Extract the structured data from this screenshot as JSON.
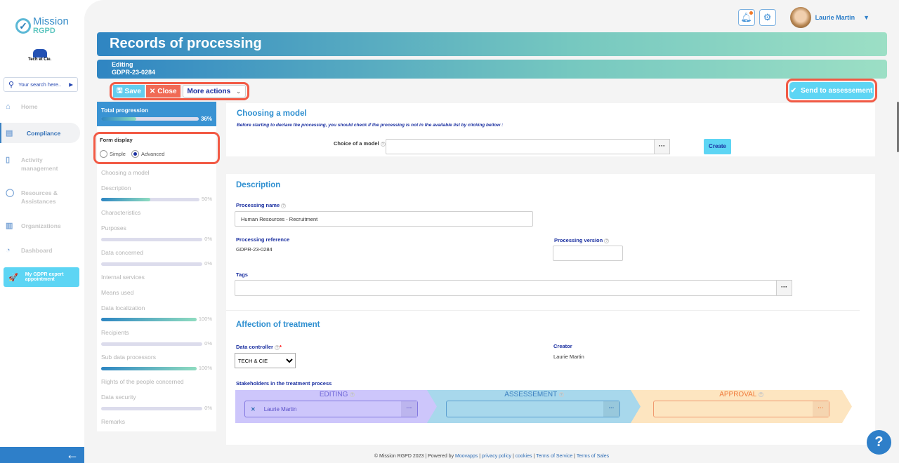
{
  "sidebar": {
    "logo_line1": "Mission",
    "logo_line2": "RGPD",
    "client_name": "Tech et Cie.",
    "search_placeholder": "Your search here..",
    "items": [
      {
        "label": "Home",
        "icon": "home-icon"
      },
      {
        "label": "Compliance",
        "icon": "document-icon",
        "active": true
      },
      {
        "label": "Activity management",
        "icon": "bookmark-icon"
      },
      {
        "label": "Resources & Assistances",
        "icon": "chat-icon"
      },
      {
        "label": "Organizations",
        "icon": "buildings-icon"
      },
      {
        "label": "Dashboard",
        "icon": "dashboard-icon"
      }
    ],
    "appointment": "My GDPR expert appointment",
    "back_icon": "arrow-left-icon"
  },
  "header": {
    "user": "Laurie Martin",
    "notification_icon": "bell-icon",
    "settings_icon": "gear-icon"
  },
  "page": {
    "title": "Records of processing",
    "status": "Editing",
    "reference": "GDPR-23-0284"
  },
  "toolbar": {
    "save": "Save",
    "close": "Close",
    "more": "More actions",
    "send": "Send to assessement"
  },
  "progress": {
    "label": "Total progression",
    "value": 36,
    "value_text": "36%"
  },
  "form_display": {
    "label": "Form display",
    "options": [
      "Simple",
      "Advanced"
    ],
    "selected": "Advanced"
  },
  "steps": [
    {
      "label": "Choosing a model"
    },
    {
      "label": "Description",
      "progress": 50,
      "text": "50%"
    },
    {
      "label": "Characteristics"
    },
    {
      "label": "Purposes",
      "progress": 0,
      "text": "0%"
    },
    {
      "label": "Data concerned",
      "progress": 0,
      "text": "0%"
    },
    {
      "label": "Internal services"
    },
    {
      "label": "Means used"
    },
    {
      "label": "Data localization",
      "progress": 100,
      "text": "100%"
    },
    {
      "label": "Recipients",
      "progress": 0,
      "text": "0%"
    },
    {
      "label": "Sub data processors",
      "progress": 100,
      "text": "100%"
    },
    {
      "label": "Rights of the people concerned"
    },
    {
      "label": "Data security",
      "progress": 0,
      "text": "0%"
    },
    {
      "label": "Remarks"
    }
  ],
  "model": {
    "title": "Choosing a model",
    "hint": "Before starting to declare the processing, you should check if the processing is not in the available list by clicking bellow :",
    "choice_label": "Choice of a model",
    "choice_value": "",
    "create": "Create"
  },
  "description": {
    "title": "Description",
    "name_label": "Processing name",
    "name_value": "Human Resources - Recruitment",
    "ref_label": "Processing reference",
    "ref_value": "GDPR-23-0284",
    "version_label": "Processing version",
    "version_value": "",
    "tags_label": "Tags",
    "tags_value": ""
  },
  "affection": {
    "title": "Affection of treatment",
    "controller_label": "Data controller",
    "controller_value": "TECH & CIE",
    "creator_label": "Creator",
    "creator_value": "Laurie Martin",
    "stakeholders_label": "Stakeholders in the treatment process",
    "stages": [
      {
        "title": "EDITING",
        "value": "Laurie Martin",
        "color": "#cdc6fb"
      },
      {
        "title": "ASSESSEMENT",
        "value": "",
        "color": "#a8d8ec"
      },
      {
        "title": "APPROVAL",
        "value": "",
        "color": "#fde5c0"
      }
    ]
  },
  "footer": {
    "copyright": "© Mission RGPD 2023 | Powered by ",
    "powered": "Moovapps",
    "privacy": "privacy policy",
    "cookies": "cookies",
    "tos": "Terms of Service",
    "sales": "Terms of Sales",
    "sep": " | "
  }
}
